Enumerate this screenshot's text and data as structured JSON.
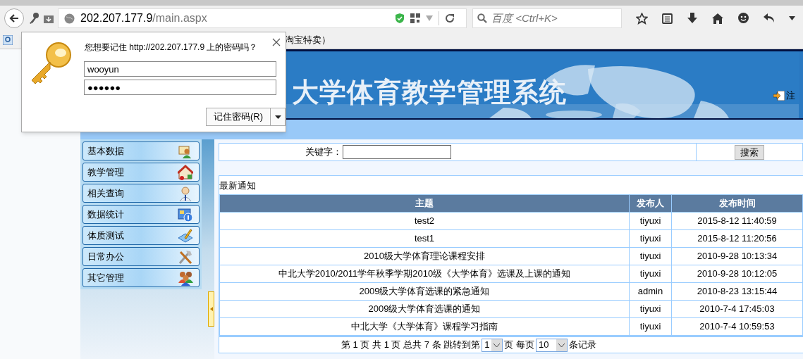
{
  "browser": {
    "url_host": "202.207.177.9",
    "url_path": "/main.aspx",
    "search_placeholder": "百度 <Ctrl+K>",
    "bookmark_text": "淘宝特卖）"
  },
  "password_prompt": {
    "message": "您想要记住 http://202.207.177.9 上的密码吗？",
    "username": "wooyun",
    "password": "●●●●●●",
    "remember_button": "记住密码(R)"
  },
  "header": {
    "title": "大学体育教学管理系统",
    "logout": "注"
  },
  "sidebar": {
    "items": [
      {
        "label": "基本数据"
      },
      {
        "label": "教学管理"
      },
      {
        "label": "相关查询"
      },
      {
        "label": "数据统计"
      },
      {
        "label": "体质测试"
      },
      {
        "label": "日常办公"
      },
      {
        "label": "其它管理"
      }
    ]
  },
  "search": {
    "label": "关键字：",
    "button": "搜索"
  },
  "notices": {
    "title": "最新通知",
    "columns": [
      "主题",
      "发布人",
      "发布时间"
    ],
    "rows": [
      [
        "test2",
        "tiyuxi",
        "2015-8-12 11:40:59"
      ],
      [
        "test1",
        "tiyuxi",
        "2015-8-12 11:20:56"
      ],
      [
        "2010级大学体育理论课程安排",
        "tiyuxi",
        "2010-9-28 10:13:34"
      ],
      [
        "中北大学2010/2011学年秋季学期2010级《大学体育》选课及上课的通知",
        "tiyuxi",
        "2010-9-28 10:12:05"
      ],
      [
        "2009级大学体育选课的紧急通知",
        "admin",
        "2010-8-23 13:15:44"
      ],
      [
        "2009级大学体育选课的通知",
        "tiyuxi",
        "2010-7-4 17:45:03"
      ],
      [
        "中北大学《大学体育》课程学习指南",
        "tiyuxi",
        "2010-7-4 10:59:53"
      ]
    ]
  },
  "pager": {
    "text_1": "第 1 页 共 1 页 总共 7 条 跳转到第",
    "page_select": "1",
    "text_2": "页 每页",
    "size_select": "10",
    "text_3": "条记录"
  }
}
